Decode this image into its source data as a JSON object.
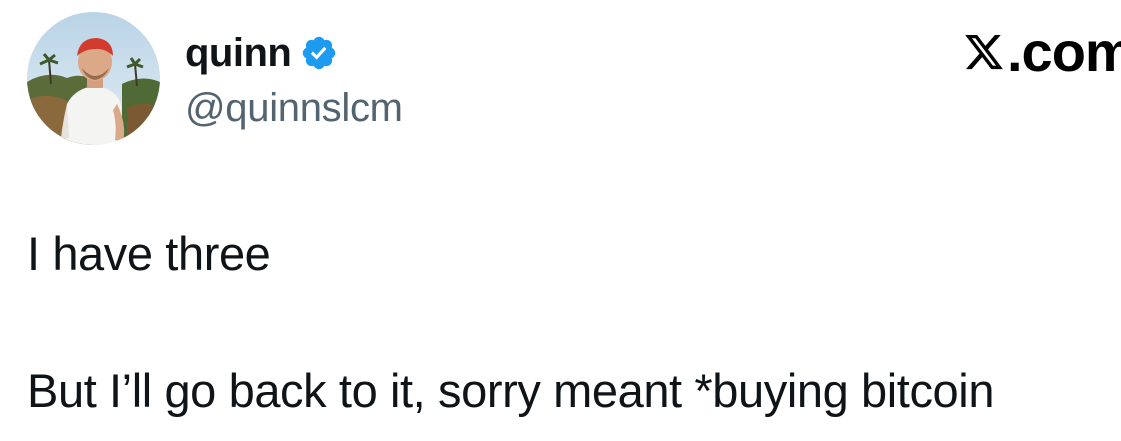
{
  "author": {
    "display_name": "quinn",
    "handle": "@quinnslcm",
    "verified": true,
    "verified_color": "#1d9bf0",
    "avatar_icon": "profile-photo"
  },
  "brand": {
    "logo_icon": "x-logo-icon",
    "suffix": ".com"
  },
  "tweet": {
    "lines": [
      "I have three",
      "But I’ll go back to it, sorry meant *buying bitcoin"
    ]
  },
  "colors": {
    "text_primary": "#0f1419",
    "text_secondary": "#536471",
    "background": "#ffffff"
  }
}
